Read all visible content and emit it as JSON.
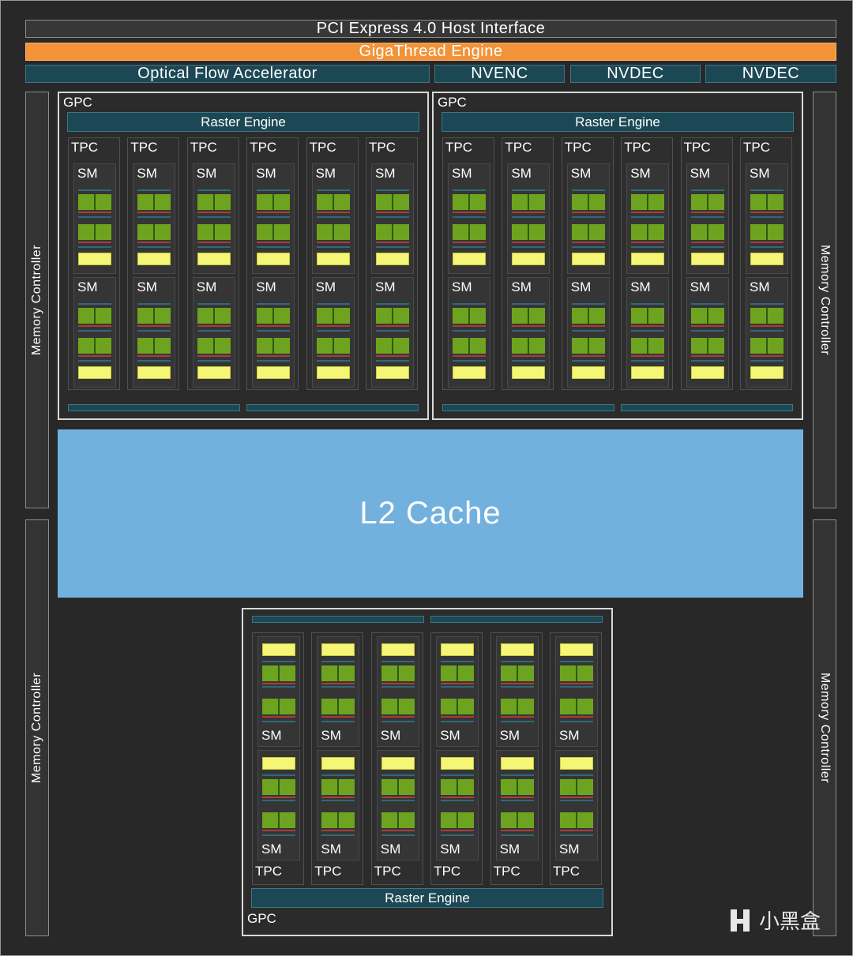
{
  "top": {
    "pcie": "PCI Express 4.0 Host Interface",
    "gigathread": "GigaThread Engine",
    "accelerators": [
      "Optical Flow Accelerator",
      "NVENC",
      "NVDEC",
      "NVDEC"
    ]
  },
  "memory_controller": "Memory Controller",
  "l2_cache": "L2 Cache",
  "gpc": {
    "label": "GPC",
    "raster": "Raster Engine",
    "tpc": "TPC",
    "sm": "SM"
  },
  "watermark": "小黑盒",
  "colors": {
    "background": "#282828",
    "gigathread": "#f29338",
    "l2_cache": "#72b1de",
    "engine": "#1c4855",
    "cuda_cores": "#6ea31f",
    "rt_core": "#f5f576"
  }
}
